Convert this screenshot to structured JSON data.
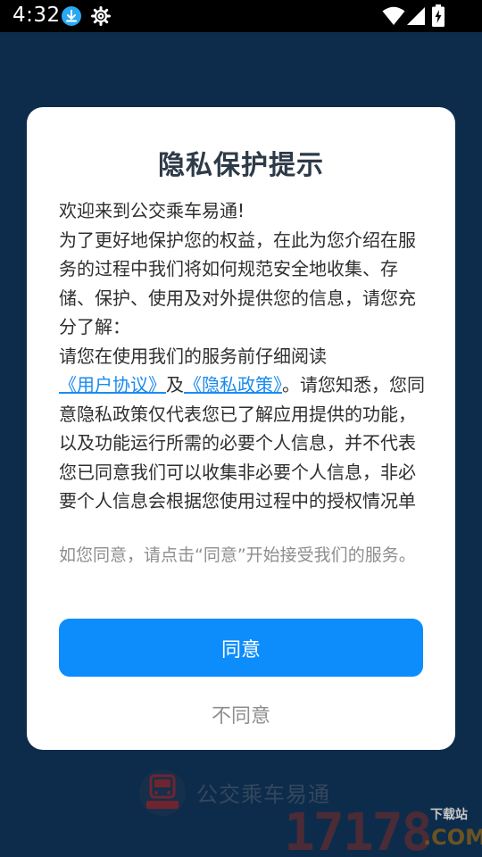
{
  "status_bar": {
    "time": "4:32",
    "icons": [
      "download-icon",
      "gear-icon",
      "wifi-icon",
      "signal-icon",
      "battery-charging-icon"
    ]
  },
  "background": {
    "app_name": "公交乘车易通",
    "logo_caption": "公交乘车易通",
    "watermark_number": "17178",
    "watermark_site": "下载站",
    "watermark_domain": ".COM"
  },
  "dialog": {
    "title": "隐私保护提示",
    "body": {
      "p1": "欢迎来到公交乘车易通!",
      "p2": "为了更好地保护您的权益，在此为您介绍在服务的过程中我们将如何规范安全地收集、存储、保护、使用及对外提供您的信息，请您充分了解：",
      "p3_pre": "请您在使用我们的服务前仔细阅读",
      "p3_link1": "《用户协议》",
      "p3_mid": "及",
      "p3_link2": "《隐私政策》",
      "p3_post": "。请您知悉，您同意隐私政策仅代表您已了解应用提供的功能，以及功能运行所需的必要个人信息，并不代表您已同意我们可以收集非必要个人信息，非必要个人信息会根据您使用过程中的授权情况单独征求"
    },
    "note": "如您同意，请点击“同意”开始接受我们的服务。",
    "agree_label": "同意",
    "disagree_label": "不同意"
  },
  "colors": {
    "primary": "#0d8cfb",
    "link": "#1a8af0",
    "backdrop": "#0d2c4c"
  }
}
